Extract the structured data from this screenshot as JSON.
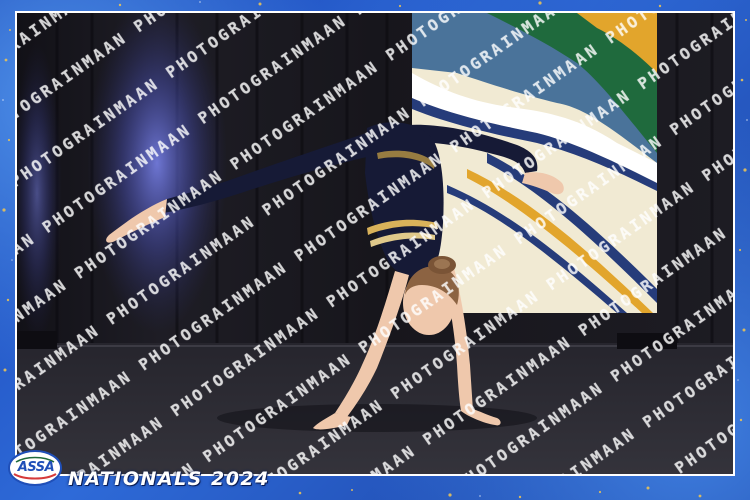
{
  "photo": {
    "subject": "gymnast",
    "watermark_text": "INMAAN PHOTOGRAPHY",
    "colors": {
      "backdrop_curtain": "#1c1b22",
      "stage_floor": "#2a2a31",
      "spotlight": "#5a63c9",
      "banner_cream": "#f1ead3",
      "banner_green": "#1f6a3d",
      "banner_gold": "#e2a52c",
      "banner_navy": "#263c7a",
      "leotard": "#161a36",
      "skin": "#efc8ac"
    }
  },
  "frame": {
    "logo_text": "ASSA",
    "event_title": "NATIONALS 2024",
    "colors": {
      "border_blue": "#2c63d2",
      "border_white": "#ffffff",
      "glitter_gold": "#e8c25a"
    }
  }
}
